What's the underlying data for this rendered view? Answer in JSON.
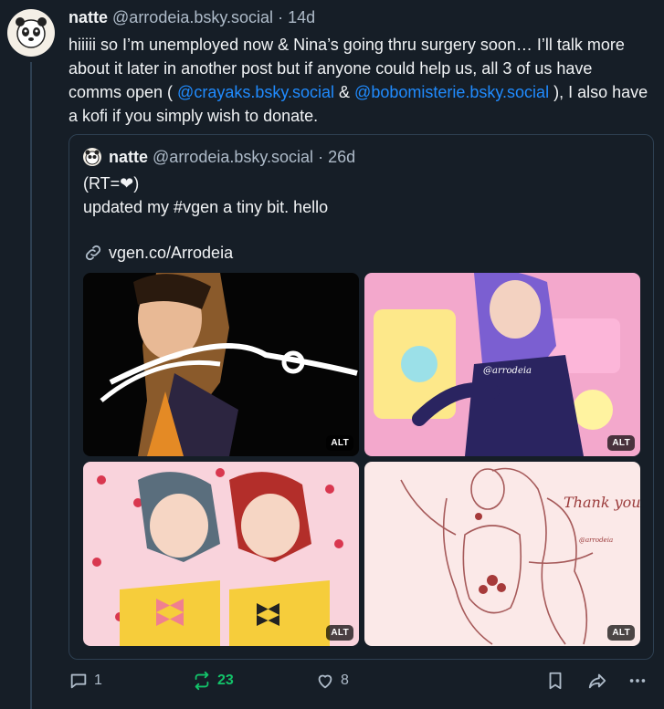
{
  "post": {
    "display_name": "natte",
    "handle": "@arrodeia.bsky.social",
    "separator": "·",
    "time": "14d",
    "text_part1": "hiiiii so I’m unemployed now & Nina’s going thru surgery soon… I’ll talk more about it later in another post but if anyone could help us, all 3 of us have comms open ( ",
    "mention1": "@crayaks.bsky.social",
    "text_part2": " & ",
    "mention2": "@bobomisterie.bsky.social",
    "text_part3": " ), I also have a kofi if you simply wish to donate."
  },
  "quote": {
    "display_name": "natte",
    "handle": "@arrodeia.bsky.social",
    "separator": "·",
    "time": "26d",
    "line1": "(RT=❤)",
    "line2": "updated my #vgen a tiny bit. hello",
    "link": "vgen.co/Arrodeia",
    "images": [
      {
        "alt_badge": "ALT",
        "icon": "artwork-braid-girl"
      },
      {
        "alt_badge": "ALT",
        "icon": "artwork-purple-hair-girl"
      },
      {
        "alt_badge": "ALT",
        "icon": "artwork-two-idols"
      },
      {
        "alt_badge": "ALT",
        "icon": "artwork-thank-you-sketch"
      }
    ],
    "watermark": "@arrodeia",
    "thank_you_text": "Thank you!"
  },
  "actions": {
    "reply_count": "1",
    "repost_count": "23",
    "like_count": "8"
  },
  "colors": {
    "background": "#161e27",
    "mention": "#208bfe",
    "repost_active": "#13c36a",
    "muted": "#aebbc9",
    "border": "#2e4052"
  }
}
